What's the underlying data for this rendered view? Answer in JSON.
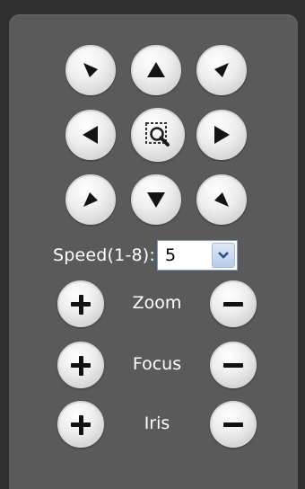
{
  "ptz": {
    "buttons": [
      {
        "name": "pan-up-left-button",
        "icon": "arrow-up-left-icon"
      },
      {
        "name": "pan-up-button",
        "icon": "arrow-up-icon"
      },
      {
        "name": "pan-up-right-button",
        "icon": "arrow-up-right-icon"
      },
      {
        "name": "pan-left-button",
        "icon": "arrow-left-icon"
      },
      {
        "name": "area-zoom-button",
        "icon": "magnifier-select-icon"
      },
      {
        "name": "pan-right-button",
        "icon": "arrow-right-icon"
      },
      {
        "name": "pan-down-left-button",
        "icon": "arrow-down-left-icon"
      },
      {
        "name": "pan-down-button",
        "icon": "arrow-down-icon"
      },
      {
        "name": "pan-down-right-button",
        "icon": "arrow-down-right-icon"
      }
    ]
  },
  "speed": {
    "label": "Speed(1-8):",
    "value": "5"
  },
  "controls": {
    "zoom_label": "Zoom",
    "focus_label": "Focus",
    "iris_label": "Iris"
  },
  "colors": {
    "panel": "#5a5a5a",
    "background": "#2f2f2f",
    "text": "#ffffff"
  }
}
